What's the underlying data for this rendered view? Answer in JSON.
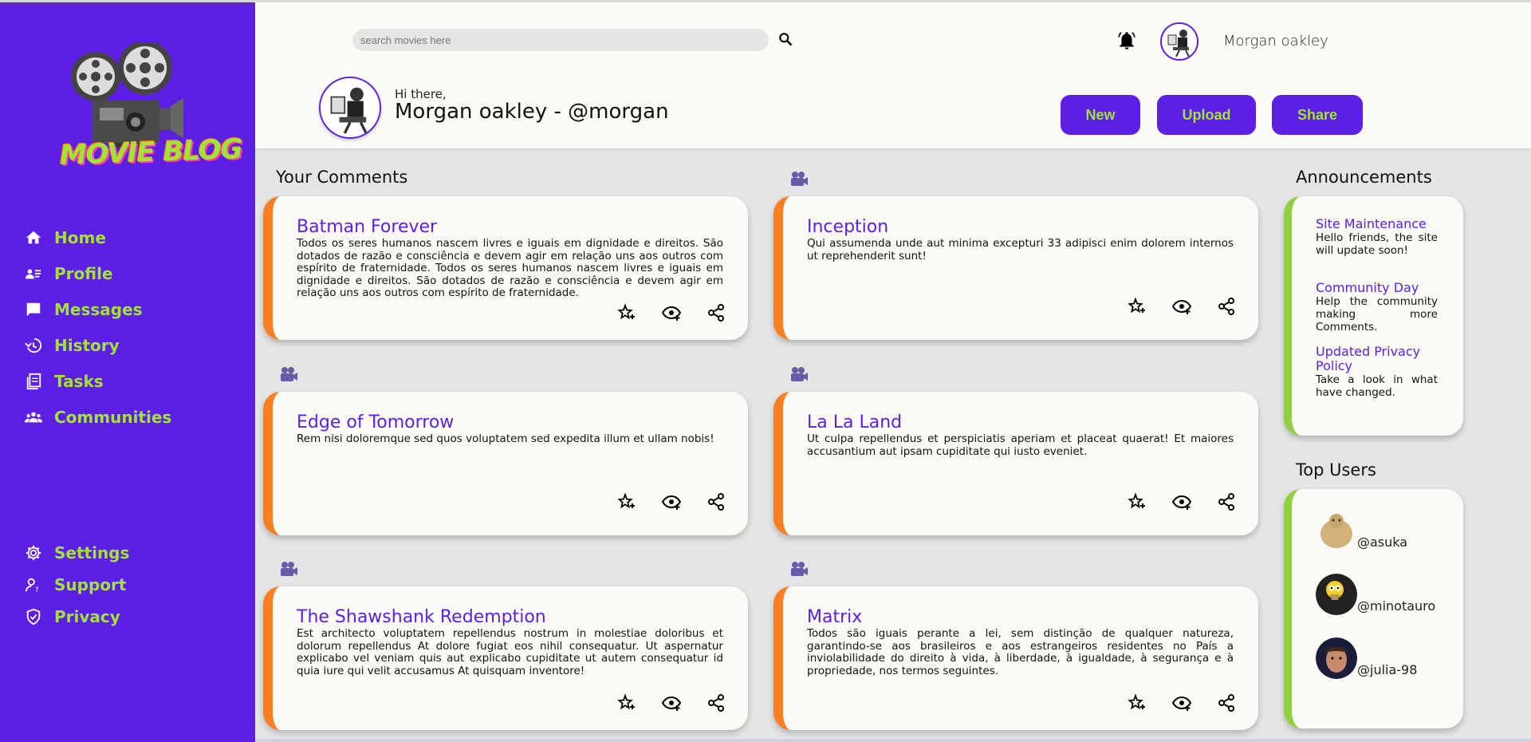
{
  "sidebar": {
    "brand": "MOVIE BLOG",
    "items": [
      {
        "label": "Home",
        "icon": "home-icon"
      },
      {
        "label": "Profile",
        "icon": "profile-icon"
      },
      {
        "label": "Messages",
        "icon": "message-icon"
      },
      {
        "label": "History",
        "icon": "history-icon"
      },
      {
        "label": "Tasks",
        "icon": "tasks-icon"
      },
      {
        "label": "Communities",
        "icon": "communities-icon"
      }
    ],
    "bottom_items": [
      {
        "label": "Settings",
        "icon": "gear-icon"
      },
      {
        "label": "Support",
        "icon": "support-icon"
      },
      {
        "label": "Privacy",
        "icon": "shield-icon"
      }
    ]
  },
  "header": {
    "search_placeholder": "search movies here",
    "user_name": "Morgan oakley",
    "greeting": "Hi there,",
    "greeting_name": "Morgan oakley - @morgan",
    "buttons": {
      "new": "New",
      "upload": "Upload",
      "share": "Share"
    }
  },
  "comments": {
    "title": "Your Comments",
    "cards": [
      {
        "title": "Batman Forever",
        "body": "Todos os seres humanos nascem livres e iguais em dignidade e direitos. São dotados de razão e consciência e devem agir em relação uns aos outros com espírito de fraternidade. Todos os seres humanos nascem livres e iguais em dignidade e direitos. São dotados de razão e consciência e devem agir em relação uns aos outros com espírito de fraternidade."
      },
      {
        "title": "Inception",
        "body": "Qui assumenda unde aut minima excepturi 33 adipisci enim dolorem internos ut reprehenderit sunt!"
      },
      {
        "title": "Edge of Tomorrow",
        "body": "Rem nisi doloremque sed quos voluptatem sed expedita illum et ullam nobis!"
      },
      {
        "title": "La La Land",
        "body": "Ut culpa repellendus et perspiciatis aperiam et placeat quaerat! Et maiores accusantium aut ipsam cupiditate qui iusto eveniet."
      },
      {
        "title": "The Shawshank Redemption",
        "body": "Est architecto voluptatem repellendus nostrum in molestiae doloribus et dolorum repellendus At dolore fugiat eos nihil consequatur. Ut aspernatur explicabo vel veniam quis aut explicabo cupiditate ut autem consequatur id quia iure qui velit accusamus At quisquam inventore!"
      },
      {
        "title": "Matrix",
        "body": "Todos são iguais perante a lei, sem distinção de qualquer natureza, garantindo-se aos brasileiros e aos estrangeiros residentes no País a inviolabilidade do direito à vida, à liberdade, à igualdade, à segurança e à propriedade, nos termos seguintes."
      }
    ]
  },
  "announcements": {
    "title": "Announcements",
    "items": [
      {
        "title": "Site Maintenance",
        "body": "Hello friends, the site will update soon!"
      },
      {
        "title": "Community Day",
        "body": "Help the community making more Comments."
      },
      {
        "title": "Updated Privacy Policy",
        "body": "Take a look in what have changed."
      }
    ]
  },
  "top_users": {
    "title": "Top Users",
    "users": [
      {
        "handle": "@asuka"
      },
      {
        "handle": "@minotauro"
      },
      {
        "handle": "@julia-98"
      }
    ]
  },
  "colors": {
    "primary": "#5d1fe3",
    "accent": "#a2e23a",
    "card_border": "#fb7f21",
    "side_border": "#8fd03f"
  }
}
